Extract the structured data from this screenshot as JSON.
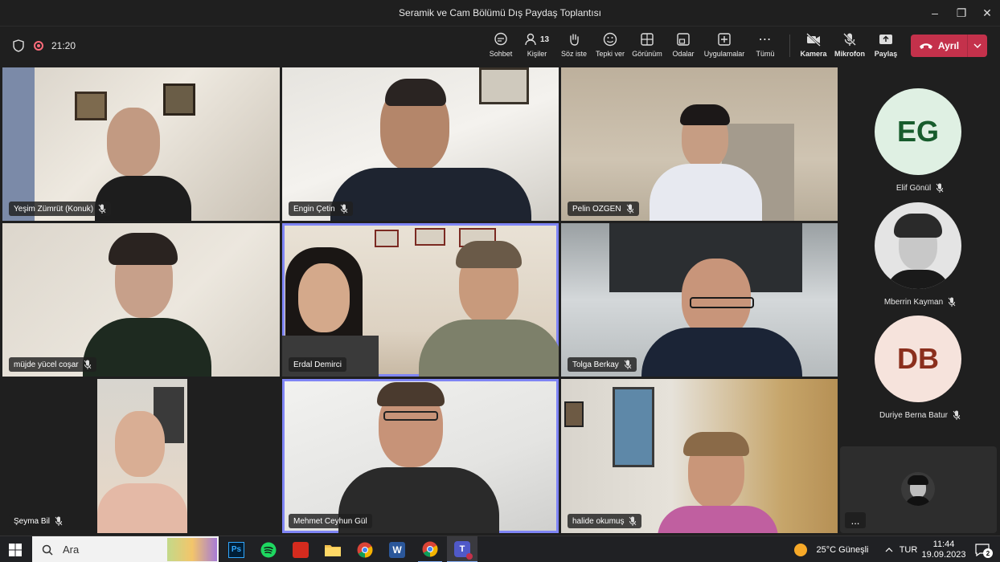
{
  "window": {
    "title": "Seramik ve Cam Bölümü Dış Paydaş Toplantısı"
  },
  "meeting": {
    "timer": "21:20"
  },
  "toolbar": {
    "chat": "Sohbet",
    "people": "Kişiler",
    "people_count": "13",
    "raise": "Söz iste",
    "react": "Tepki ver",
    "view": "Görünüm",
    "rooms": "Odalar",
    "apps": "Uygulamalar",
    "more": "Tümü",
    "camera": "Kamera",
    "mic": "Mikrofon",
    "share": "Paylaş",
    "leave": "Ayrıl"
  },
  "participants": [
    {
      "name": "Yeşim Zümrüt (Konuk)"
    },
    {
      "name": "Engin Çetin"
    },
    {
      "name": "Pelin OZGEN"
    },
    {
      "name": "müjde yücel coşar"
    },
    {
      "name": "Erdal Demirci"
    },
    {
      "name": "Tolga Berkay"
    },
    {
      "name": "Şeyma Bil"
    },
    {
      "name": "Mehmet Ceyhun Gül"
    },
    {
      "name": "halide okumuş"
    }
  ],
  "sidebar": [
    {
      "initials": "EG",
      "name": "Elif Gönül",
      "bg": "#dff0e3",
      "fg": "#175c2c"
    },
    {
      "initials": "",
      "name": "Mberrin Kayman",
      "bg": "#e4e4e4",
      "fg": "#333"
    },
    {
      "initials": "DB",
      "name": "Duriye Berna Batur",
      "bg": "#f6e3dc",
      "fg": "#8b2f1d"
    }
  ],
  "selfview": {
    "more": "..."
  },
  "taskbar": {
    "search_placeholder": "Ara",
    "weather": "25°C Güneşli",
    "lang": "TUR",
    "time": "11:44",
    "date": "19.09.2023",
    "notif_count": "2"
  }
}
